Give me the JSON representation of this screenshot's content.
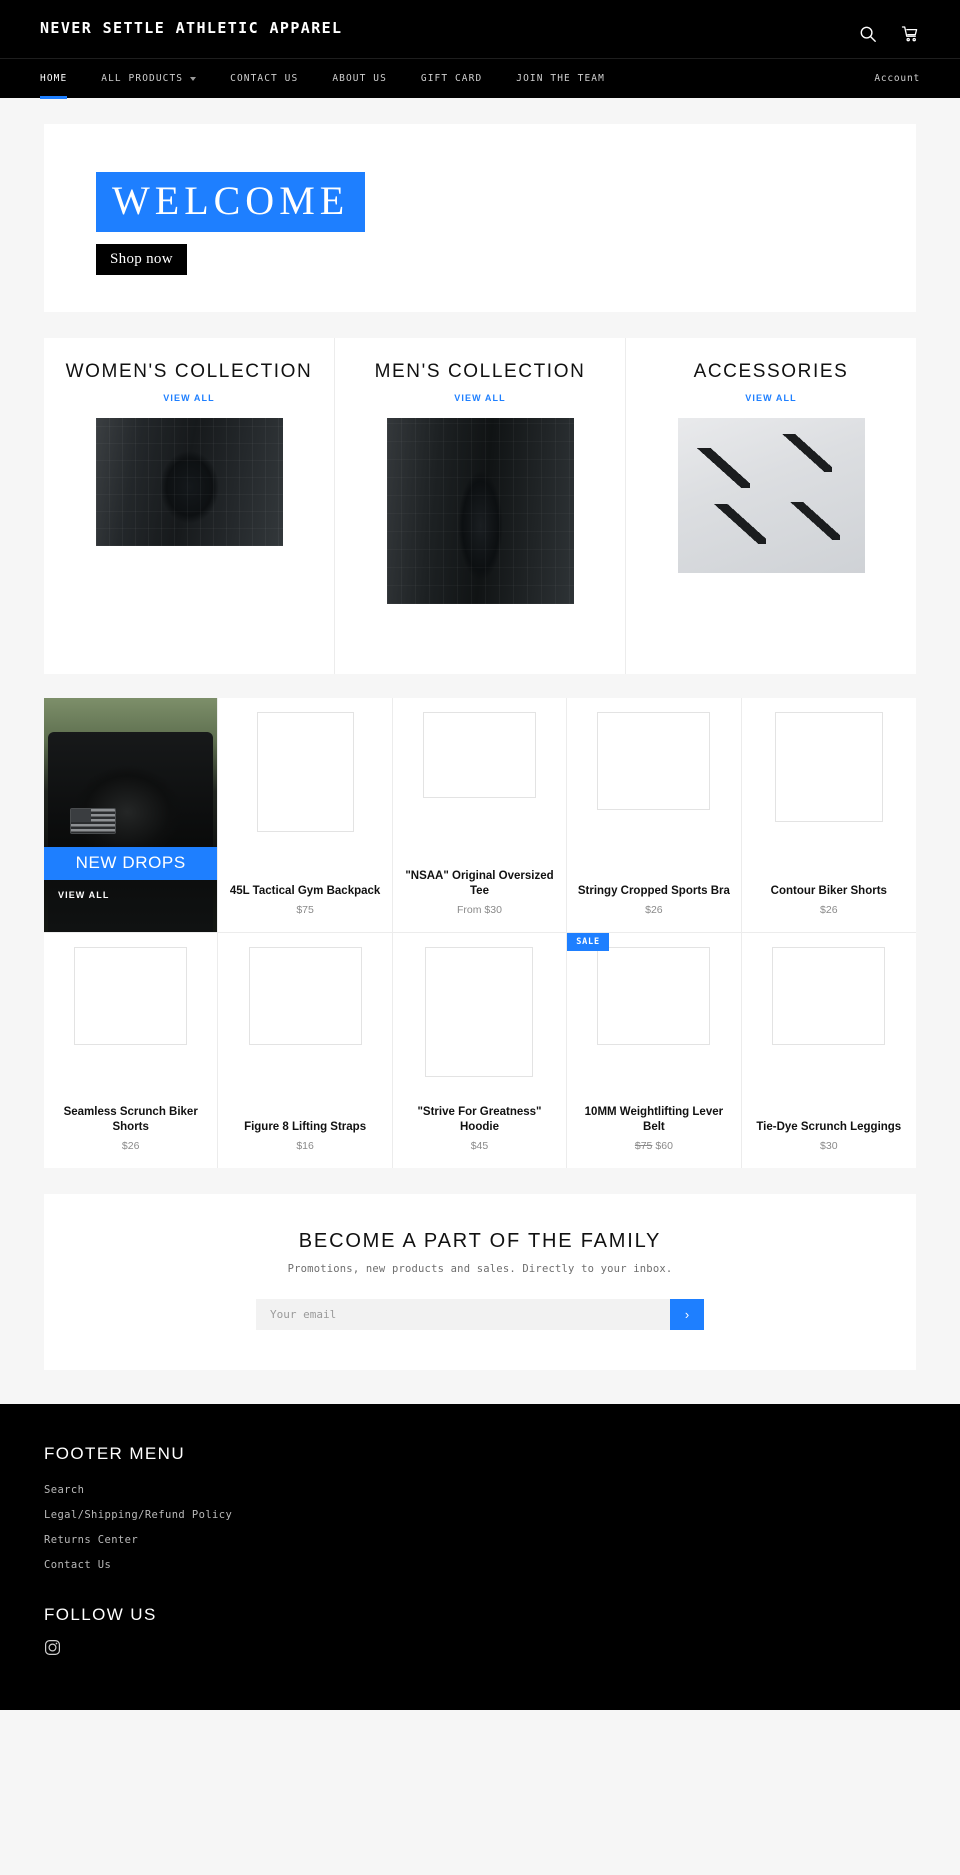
{
  "header": {
    "brand": "NEVER SETTLE ATHLETIC APPAREL",
    "search_icon": "search-icon",
    "cart_icon": "cart-icon"
  },
  "nav": {
    "items": [
      {
        "label": "HOME",
        "active": true,
        "has_caret": false
      },
      {
        "label": "ALL PRODUCTS",
        "active": false,
        "has_caret": true
      },
      {
        "label": "CONTACT US",
        "active": false,
        "has_caret": false
      },
      {
        "label": "ABOUT US",
        "active": false,
        "has_caret": false
      },
      {
        "label": "GIFT CARD",
        "active": false,
        "has_caret": false
      },
      {
        "label": "JOIN THE TEAM",
        "active": false,
        "has_caret": false
      }
    ],
    "account_label": "Account"
  },
  "hero": {
    "title": "WELCOME",
    "button_label": "Shop now"
  },
  "collections": [
    {
      "title": "WOMEN'S COLLECTION",
      "view_all": "VIEW ALL"
    },
    {
      "title": "MEN'S COLLECTION",
      "view_all": "VIEW ALL"
    },
    {
      "title": "ACCESSORIES",
      "view_all": "VIEW ALL"
    }
  ],
  "promo_tile": {
    "band_label": "NEW DROPS",
    "view_all": "VIEW ALL"
  },
  "products": [
    {
      "title": "45L Tactical Gym Backpack",
      "price": "$75",
      "price_old": "",
      "sale": false,
      "badge": ""
    },
    {
      "title": "\"NSAA\" Original Oversized Tee",
      "price": "From $30",
      "price_old": "",
      "sale": false,
      "badge": ""
    },
    {
      "title": "Stringy Cropped Sports Bra",
      "price": "$26",
      "price_old": "",
      "sale": false,
      "badge": ""
    },
    {
      "title": "Contour Biker Shorts",
      "price": "$26",
      "price_old": "",
      "sale": false,
      "badge": ""
    },
    {
      "title": "Seamless Scrunch Biker Shorts",
      "price": "$26",
      "price_old": "",
      "sale": false,
      "badge": ""
    },
    {
      "title": "Figure 8 Lifting Straps",
      "price": "$16",
      "price_old": "",
      "sale": false,
      "badge": ""
    },
    {
      "title": "\"Strive For Greatness\" Hoodie",
      "price": "$45",
      "price_old": "",
      "sale": false,
      "badge": ""
    },
    {
      "title": "10MM Weightlifting Lever Belt",
      "price": "$60",
      "price_old": "$75",
      "sale": true,
      "badge": "SALE"
    },
    {
      "title": "Tie-Dye Scrunch Leggings",
      "price": "$30",
      "price_old": "",
      "sale": false,
      "badge": ""
    }
  ],
  "newsletter": {
    "title": "BECOME A PART OF THE FAMILY",
    "subtitle": "Promotions, new products and sales. Directly to your inbox.",
    "placeholder": "Your email",
    "value": "",
    "submit_glyph": "›"
  },
  "footer": {
    "menu_heading": "FOOTER MENU",
    "menu_links": [
      "Search",
      "Legal/Shipping/Refund Policy",
      "Returns Center",
      "Contact Us"
    ],
    "follow_heading": "FOLLOW US",
    "social": [
      {
        "name": "instagram-icon",
        "label": "Instagram"
      }
    ]
  },
  "colors": {
    "accent_blue": "#1e7fff",
    "black": "#000000",
    "page_bg": "#f6f6f6",
    "card_bg": "#ffffff",
    "muted_text": "#8a8a8a"
  }
}
